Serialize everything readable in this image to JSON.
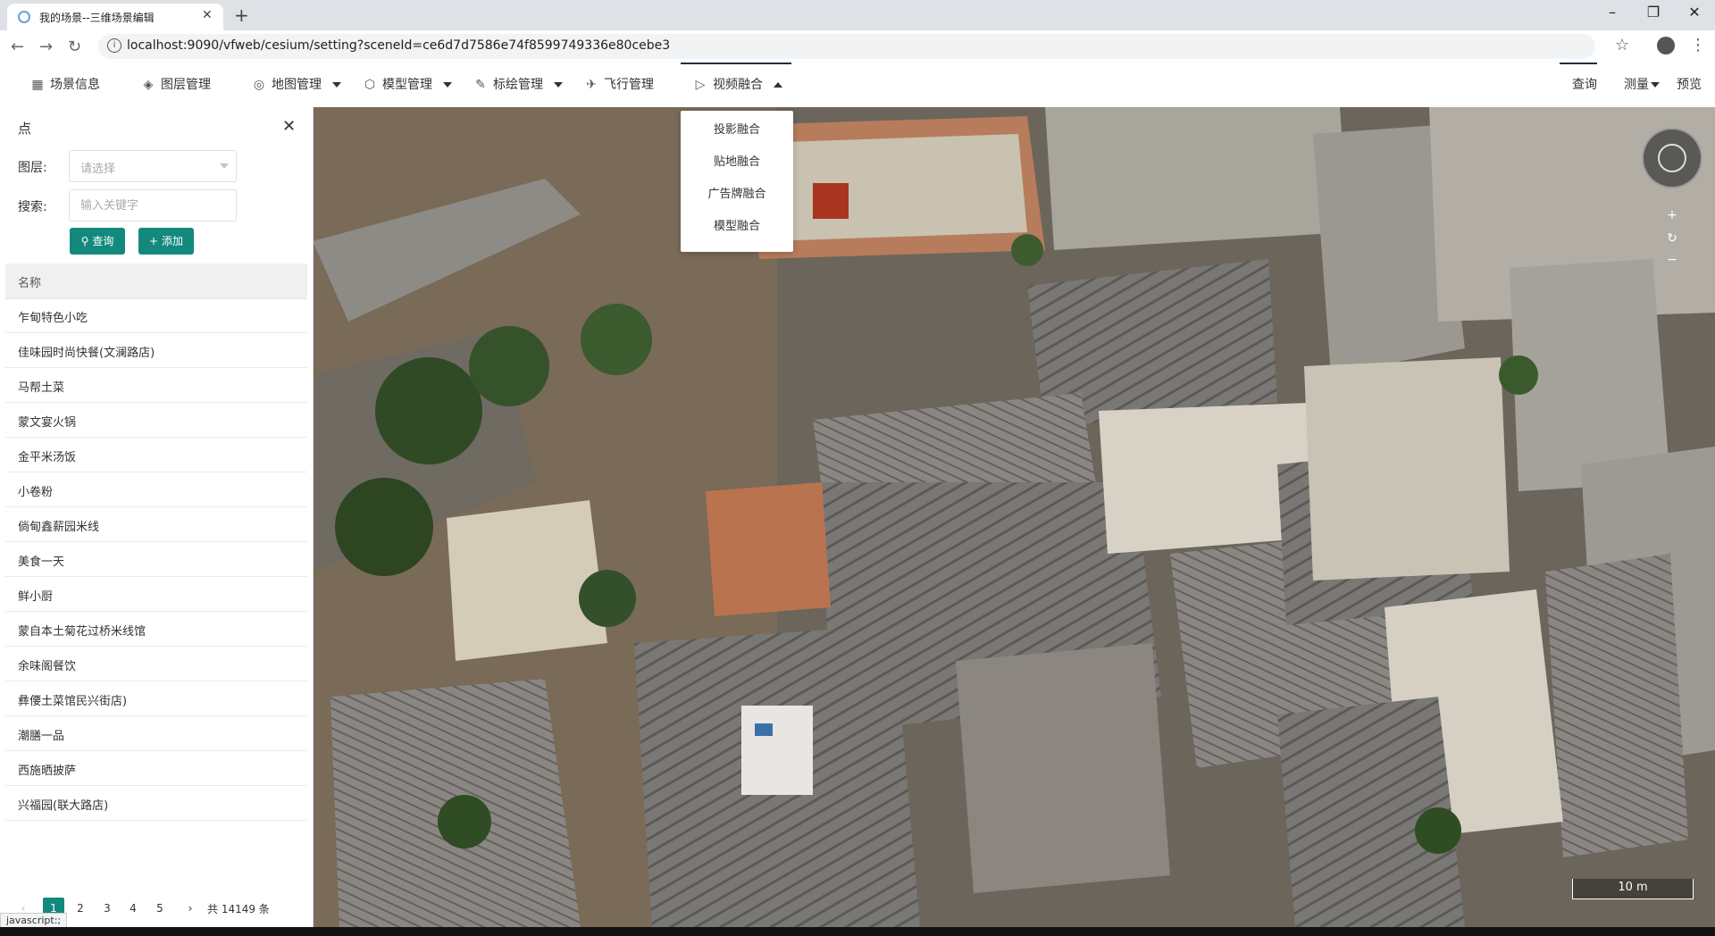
{
  "browser": {
    "tab_title": "我的场景--三维场景编辑",
    "url": "localhost:9090/vfweb/cesium/setting?sceneId=ce6d7d7586e74f8599749336e80cebe3",
    "status_tip": "javascript:;"
  },
  "menu": {
    "items": [
      {
        "label": "场景信息",
        "icon": "scene-icon"
      },
      {
        "label": "图层管理",
        "icon": "layers-icon"
      },
      {
        "label": "地图管理",
        "icon": "globe-icon"
      },
      {
        "label": "模型管理",
        "icon": "cube-icon"
      },
      {
        "label": "标绘管理",
        "icon": "pen-icon"
      },
      {
        "label": "飞行管理",
        "icon": "plane-icon"
      },
      {
        "label": "视频融合",
        "icon": "video-icon"
      }
    ],
    "right": [
      "查询",
      "测量",
      "预览"
    ],
    "dropdown": [
      "投影融合",
      "贴地融合",
      "广告牌融合",
      "模型融合"
    ]
  },
  "panel": {
    "title": "点",
    "layer_label": "图层:",
    "layer_placeholder": "请选择",
    "search_label": "搜索:",
    "search_placeholder": "输入关键字",
    "query_btn": "查询",
    "add_btn": "添加",
    "column": "名称",
    "rows": [
      "乍甸特色小吃",
      "佳味园时尚快餐(文澜路店)",
      "马帮土菜",
      "蒙文宴火锅",
      "金平米汤饭",
      "小卷粉",
      "倘甸鑫薪园米线",
      "美食一天",
      "鲜小厨",
      "蒙自本土菊花过桥米线馆",
      "余味阁餐饮",
      "彝偠土菜馆民兴街店)",
      "潮膳一品",
      "西施晒披萨",
      "兴福园(联大路店)"
    ],
    "pager": {
      "pages": [
        "1",
        "2",
        "3",
        "4",
        "5"
      ],
      "current": "1",
      "total": "共 14149 条"
    }
  },
  "map": {
    "scale_label": "10 m"
  }
}
